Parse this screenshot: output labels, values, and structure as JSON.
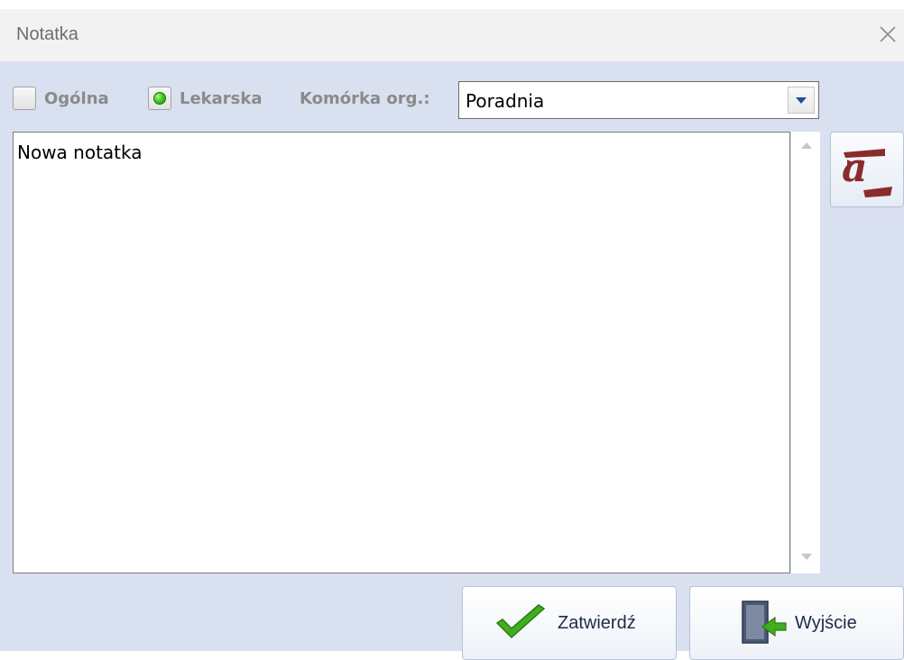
{
  "window": {
    "title": "Notatka"
  },
  "options": {
    "general_label": "Ogólna",
    "general_checked": false,
    "medical_label": "Lekarska",
    "medical_checked": true,
    "org_unit_label": "Komórka org.:",
    "org_unit_value": "Poradnia"
  },
  "editor": {
    "text": "Nowa notatka"
  },
  "buttons": {
    "confirm_label": "Zatwierdź",
    "exit_label": "Wyjście"
  },
  "icons": {
    "close": "close-icon",
    "dropdown": "chevron-down-icon",
    "font": "font-format-icon",
    "confirm": "checkmark-icon",
    "exit": "door-exit-icon"
  }
}
